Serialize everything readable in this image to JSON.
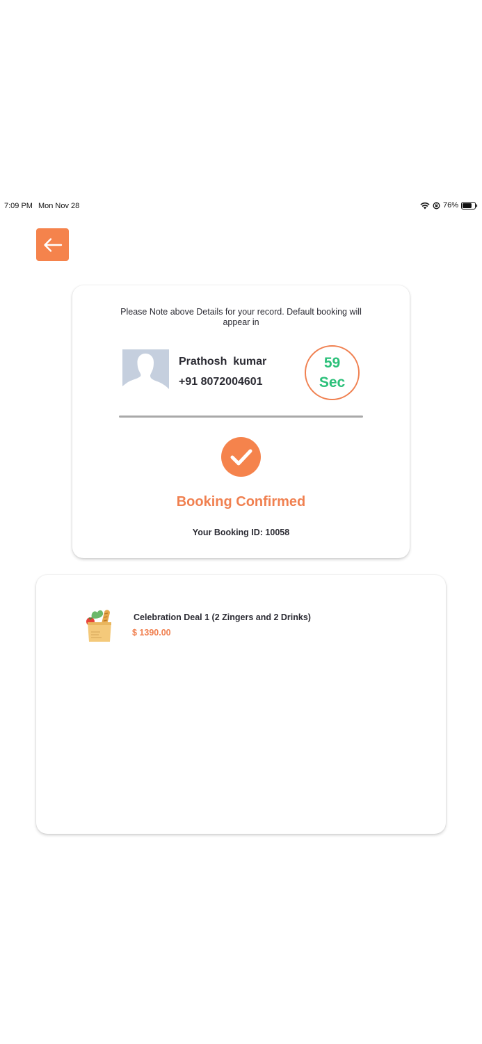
{
  "status_bar": {
    "time": "7:09 PM",
    "date": "Mon Nov 28",
    "battery": "76%",
    "battery_level": 0.76
  },
  "back_button": {
    "icon": "arrow-left-icon"
  },
  "confirmation": {
    "note": "Please Note above Details for your record. Default booking will appear in",
    "user": {
      "name": "Prathosh  kumar",
      "phone": "+91 8072004601"
    },
    "timer": {
      "value": "59",
      "unit": "Sec"
    },
    "title": "Booking Confirmed",
    "booking_id": "Your Booking ID: 10058"
  },
  "order": {
    "items": [
      {
        "name": "Celebration Deal 1 (2 Zingers and 2 Drinks)",
        "price": "$ 1390.00",
        "icon": "grocery-bag-icon"
      }
    ]
  },
  "colors": {
    "accent": "#f5834c",
    "timer_text": "#2cc07a",
    "divider": "#a9a9a9",
    "avatar_bg": "#c5cfde"
  }
}
